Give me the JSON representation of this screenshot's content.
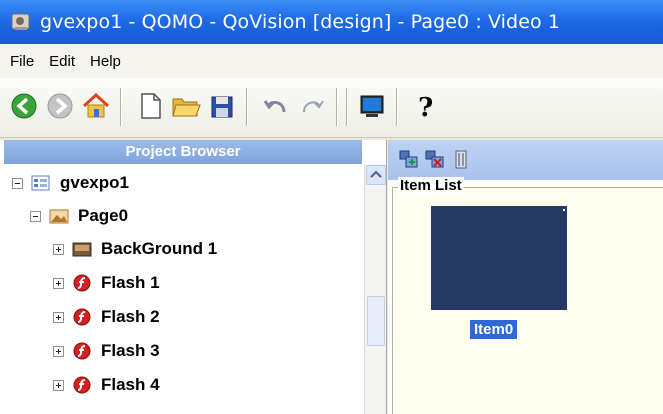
{
  "window": {
    "title": "gvexpo1 - QOMO - QoVision [design] - Page0 : Video 1",
    "app_icon": "qovision-app-icon"
  },
  "menu": {
    "items": [
      {
        "label": "File"
      },
      {
        "label": "Edit"
      },
      {
        "label": "Help"
      }
    ]
  },
  "toolbar": {
    "buttons": [
      {
        "name": "back-icon",
        "color": "#3aa33a"
      },
      {
        "name": "forward-icon",
        "color": "#b8b8b8"
      },
      {
        "name": "home-icon",
        "color": "#e8a020"
      },
      {
        "name": "new-page-icon",
        "color": "#ffffff"
      },
      {
        "name": "open-folder-icon",
        "color": "#f2c744"
      },
      {
        "name": "save-icon",
        "color": "#2c4fa8"
      },
      {
        "name": "undo-icon",
        "color": "#8890a8"
      },
      {
        "name": "redo-icon",
        "color": "#8890a8"
      },
      {
        "name": "monitor-icon",
        "color": "#1e7ad8"
      },
      {
        "name": "help-icon",
        "color": "#000000"
      }
    ]
  },
  "project_browser": {
    "header": "Project Browser",
    "tree": [
      {
        "label": "gvexpo1",
        "level": 0,
        "expanded": true,
        "icon": "project-icon"
      },
      {
        "label": "Page0",
        "level": 1,
        "expanded": true,
        "icon": "page-icon"
      },
      {
        "label": "BackGround 1",
        "level": 2,
        "expanded": false,
        "icon": "background-icon"
      },
      {
        "label": "Flash 1",
        "level": 2,
        "expanded": false,
        "icon": "flash-icon"
      },
      {
        "label": "Flash 2",
        "level": 2,
        "expanded": false,
        "icon": "flash-icon"
      },
      {
        "label": "Flash 3",
        "level": 2,
        "expanded": false,
        "icon": "flash-icon"
      },
      {
        "label": "Flash 4",
        "level": 2,
        "expanded": false,
        "icon": "flash-icon"
      }
    ]
  },
  "item_list": {
    "toolbar_icons": [
      "add-item-icon",
      "remove-item-icon",
      "delete-item-icon"
    ],
    "title": "Item List",
    "items": [
      {
        "label": "Item0",
        "selected": true,
        "thumbnail_color": "#243a63"
      }
    ]
  },
  "colors": {
    "title_bar": "#1f6ae6",
    "header_blue": "#7da2dc",
    "selection": "#2e69d6"
  }
}
